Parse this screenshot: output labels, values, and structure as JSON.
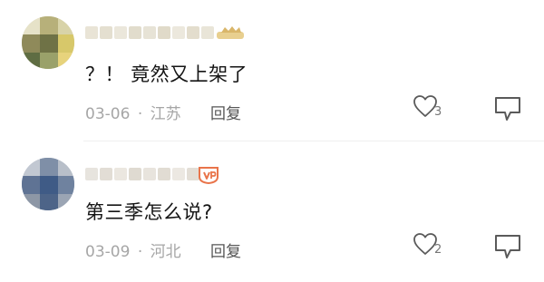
{
  "comments": [
    {
      "text": "？！ 竟然又上架了",
      "date": "03-06",
      "separator": "·",
      "location": "江苏",
      "reply_label": "回复",
      "like_count": "3"
    },
    {
      "text": "第三季怎么说?",
      "date": "03-09",
      "separator": "·",
      "location": "河北",
      "reply_label": "回复",
      "like_count": "2"
    }
  ],
  "colors": {
    "text": "#151515",
    "meta": "#a6a6a6",
    "reply": "#555555",
    "badge1": "#d9b66a",
    "badge2": "#e9744a"
  }
}
